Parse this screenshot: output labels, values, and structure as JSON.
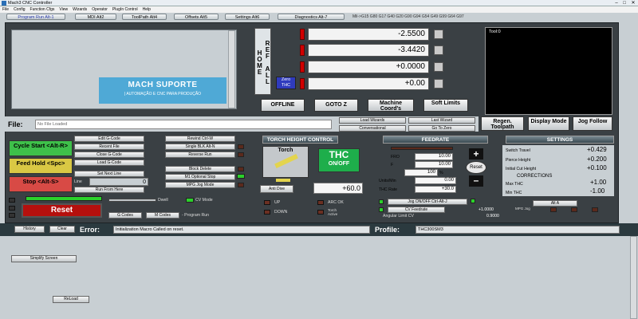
{
  "window": {
    "title": "Mach3 CNC Controller",
    "min": "–",
    "max": "□",
    "close": "✕"
  },
  "menu": [
    "File",
    "Config",
    "Function Cfgs",
    "View",
    "Wizards",
    "Operator",
    "PlugIn Control",
    "Help"
  ],
  "tabs": [
    {
      "label": "Program Run Alt-1",
      "active": true
    },
    {
      "label": "MDI Alt2"
    },
    {
      "label": "ToolPath Alt4"
    },
    {
      "label": "Offsets Alt5"
    },
    {
      "label": "Settings Alt6"
    },
    {
      "label": "Diagnostics Alt-7"
    }
  ],
  "status_codes": "Mil->G15  G80 G17 G40 G20 G90 G94 G54 G49 G99 G64 G97",
  "logo": {
    "line1": "MACH SUPORTE",
    "line2": "| AUTOMAÇÃO E CNC PARA PRODUÇÃO"
  },
  "ref_all_home": "REF ALL HOME",
  "zero_thc": "Zero THC",
  "dro": [
    {
      "value": "-2.5500"
    },
    {
      "value": "-3.4420"
    },
    {
      "value": "+0.0000"
    },
    {
      "value": "+0.00"
    }
  ],
  "dro_buttons": {
    "offline": "OFFLINE",
    "gotoz": "GOTO Z",
    "coords": "Machine Coord's",
    "softlimits": "Soft Limits"
  },
  "tool_label": "Tool:0",
  "file": {
    "label": "File:",
    "value": "No File Loaded"
  },
  "wizard": {
    "load": "Load Wizards",
    "last": "Last Wizard",
    "conv": "Conversational",
    "gotozero": "Go To Zero"
  },
  "view_buttons": {
    "regen": "Regen. Toolpath",
    "display": "Display Mode",
    "jog": "Jog Follow"
  },
  "cycle": {
    "start": "Cycle Start <Alt-R>",
    "hold": "Feed Hold <Spc>",
    "stop": "Stop <Alt-S>",
    "reset": "Reset"
  },
  "gcode_buttons": [
    "Edit G-Code",
    "Recent File",
    "Close G-Code",
    "Load G-Code"
  ],
  "set_next_line": "Set Next Line",
  "line_label": "Line",
  "line_value": "0",
  "run_from_here": "Run From Here",
  "right_buttons": [
    "Rewind Ctrl-W",
    "Single BLK Alt-N",
    "Reverse Run"
  ],
  "right_buttons2": [
    "Block Delete",
    "M1 Optional Stop",
    "MPG Jog Mode"
  ],
  "dwell": "Dwell",
  "cv_mode": "CV Mode",
  "gcodes": "G Codes",
  "mcodes": "M Codes",
  "program_run": "- Program Run",
  "thc": {
    "head": "TORCH HEIGHT CONTROL",
    "torch": "Torch",
    "thc": "THC",
    "onoff": "ON/OFF",
    "antidive": "Anti Dive",
    "value": "+60.0",
    "up": "UP",
    "down": "DOWN",
    "arcok": "ARC OK",
    "torch_active": "Torch Active"
  },
  "feedrate": {
    "head": "FEEDRATE",
    "fro": "FRO",
    "fro_val": "10.00",
    "f": "F",
    "f_val": "10.00",
    "pct_val": "100",
    "pct_sign": "%",
    "units": "Units/Min",
    "units_val": "0.00",
    "thcrate": "THC Rate",
    "thcrate_val": "+30.0",
    "reset": "Reset",
    "plus": "+",
    "minus": "–",
    "jog": "Jog ON/OFF Ctrl-Alt-J",
    "cvfeed": "CV Feedrate",
    "cvfeed_val": "+1.0000",
    "angular": "Angular Limit CV",
    "angular_val": "0.9000"
  },
  "settings": {
    "head": "SETTINGS",
    "rows": [
      {
        "label": "Switch Travel",
        "value": "+0.429"
      },
      {
        "label": "Pierce Height",
        "value": "+0.200"
      },
      {
        "label": "Initial Cut Height",
        "value": "+0.100"
      }
    ],
    "corrections": "CORRECTIONS",
    "rows2": [
      {
        "label": "Max THC",
        "value": "+1.00"
      },
      {
        "label": "Min THC",
        "value": "-1.00"
      }
    ],
    "alta": "Alt A",
    "mpg": "MPG Jog"
  },
  "bottom": {
    "history": "History",
    "clear": "Clear",
    "error_label": "Error:",
    "error_value": "Initialization Macro Called on reset.",
    "profile_label": "Profile:",
    "profile_value": "THC300SM3"
  },
  "lower": {
    "simplify": "Simplify Screen",
    "reload": "ReLoad"
  }
}
